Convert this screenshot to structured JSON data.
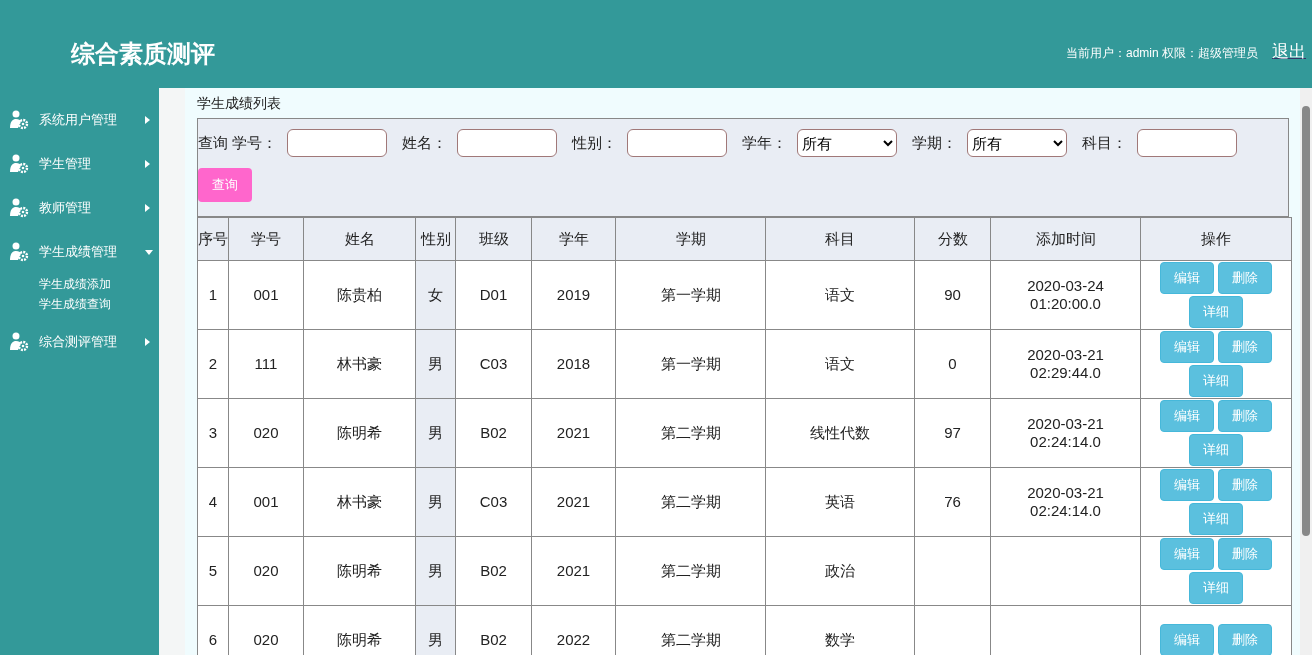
{
  "app_title": "综合素质测评",
  "user_info": "当前用户：admin  权限：超级管理员",
  "logout": "退出",
  "sidebar": {
    "items": [
      {
        "label": "系统用户管理",
        "expanded": false
      },
      {
        "label": "学生管理",
        "expanded": false
      },
      {
        "label": "教师管理",
        "expanded": false
      },
      {
        "label": "学生成绩管理",
        "expanded": true,
        "children": [
          {
            "label": "学生成绩添加"
          },
          {
            "label": "学生成绩查询"
          }
        ]
      },
      {
        "label": "综合测评管理",
        "expanded": false
      }
    ]
  },
  "panel_title": "学生成绩列表",
  "search": {
    "prefix": "查询",
    "fields": [
      {
        "kind": "text",
        "label": "学号："
      },
      {
        "kind": "text",
        "label": "姓名："
      },
      {
        "kind": "text",
        "label": "性别："
      },
      {
        "kind": "select",
        "label": "学年：",
        "value": "所有"
      },
      {
        "kind": "select",
        "label": "学期：",
        "value": "所有"
      },
      {
        "kind": "text",
        "label": "科目："
      }
    ],
    "button": "查询"
  },
  "table": {
    "columns": [
      "序号",
      "学号",
      "姓名",
      "性别",
      "班级",
      "学年",
      "学期",
      "科目",
      "分数",
      "添加时间",
      "操作"
    ],
    "rows": [
      {
        "cells": [
          "1",
          "001",
          "陈贵柏",
          "女",
          "D01",
          "2019",
          "第一学期",
          "语文",
          "90",
          "2020-03-24 01:20:00.0"
        ],
        "actions": [
          "编辑",
          "删除",
          "详细"
        ]
      },
      {
        "cells": [
          "2",
          "111",
          "林书豪",
          "男",
          "C03",
          "2018",
          "第一学期",
          "语文",
          "0",
          "2020-03-21 02:29:44.0"
        ],
        "actions": [
          "编辑",
          "删除",
          "详细"
        ]
      },
      {
        "cells": [
          "3",
          "020",
          "陈明希",
          "男",
          "B02",
          "2021",
          "第二学期",
          "线性代数",
          "97",
          "2020-03-21 02:24:14.0"
        ],
        "actions": [
          "编辑",
          "删除",
          "详细"
        ]
      },
      {
        "cells": [
          "4",
          "001",
          "林书豪",
          "男",
          "C03",
          "2021",
          "第二学期",
          "英语",
          "76",
          "2020-03-21 02:24:14.0"
        ],
        "actions": [
          "编辑",
          "删除",
          "详细"
        ]
      },
      {
        "cells": [
          "5",
          "020",
          "陈明希",
          "男",
          "B02",
          "2021",
          "第二学期",
          "政治"
        ],
        "actions": [
          "编辑",
          "删除",
          "详细"
        ]
      },
      {
        "cells": [
          "6",
          "020",
          "陈明希",
          "男",
          "B02",
          "2022",
          "第二学期",
          "数学"
        ],
        "actions": [
          "编辑",
          "删除"
        ]
      }
    ]
  }
}
